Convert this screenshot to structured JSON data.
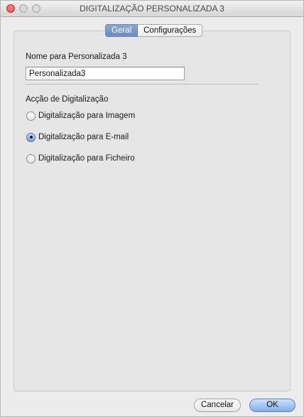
{
  "window": {
    "title": "DIGITALIZAÇÃO PERSONALIZADA 3"
  },
  "tabs": [
    {
      "label": "Geral",
      "selected": true
    },
    {
      "label": "Configurações",
      "selected": false
    }
  ],
  "name_section": {
    "label": "Nome para Personalizada 3",
    "value": "Personalizada3"
  },
  "action_section": {
    "label": "Acção de Digitalização",
    "options": [
      {
        "label": "Digitalização para Imagem",
        "checked": false
      },
      {
        "label": "Digitalização para E-mail",
        "checked": true
      },
      {
        "label": "Digitalização para Ficheiro",
        "checked": false
      }
    ]
  },
  "buttons": {
    "cancel": "Cancelar",
    "ok": "OK"
  }
}
